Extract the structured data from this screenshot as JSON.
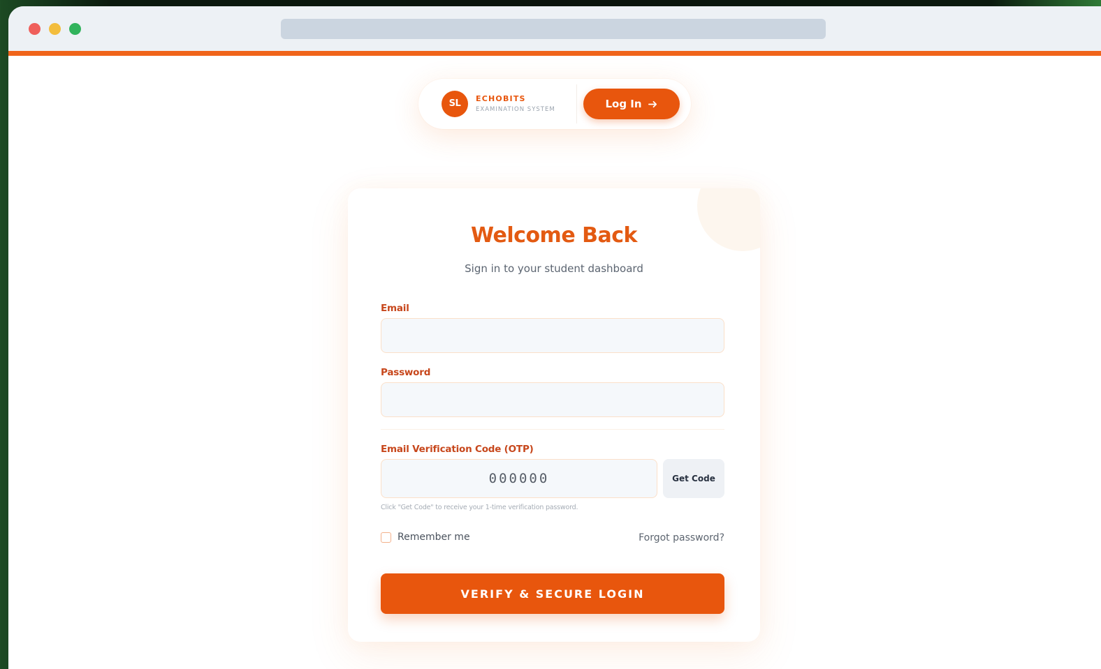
{
  "header": {
    "logo_initials": "SL",
    "brand_name": "ECHOBITS",
    "brand_subtitle": "EXAMINATION SYSTEM",
    "login_label": "Log In",
    "login_icon": "arrow-right-icon"
  },
  "card": {
    "title": "Welcome Back",
    "subtitle": "Sign in to your student dashboard",
    "email": {
      "label": "Email",
      "value": "",
      "placeholder": ""
    },
    "password": {
      "label": "Password",
      "value": "",
      "placeholder": ""
    },
    "otp": {
      "label": "Email Verification Code (OTP)",
      "placeholder": "000000",
      "get_code_label": "Get Code",
      "hint": "Click \"Get Code\" to receive your 1-time verification password."
    },
    "remember_label": "Remember me",
    "remember_checked": false,
    "forgot_label": "Forgot password?",
    "submit_label": "VERIFY & SECURE LOGIN"
  },
  "colors": {
    "accent": "#e8560d",
    "label": "#c7471c",
    "title": "#e35a12",
    "input_bg": "#f5f8fb",
    "input_border": "#fbe0c9"
  }
}
